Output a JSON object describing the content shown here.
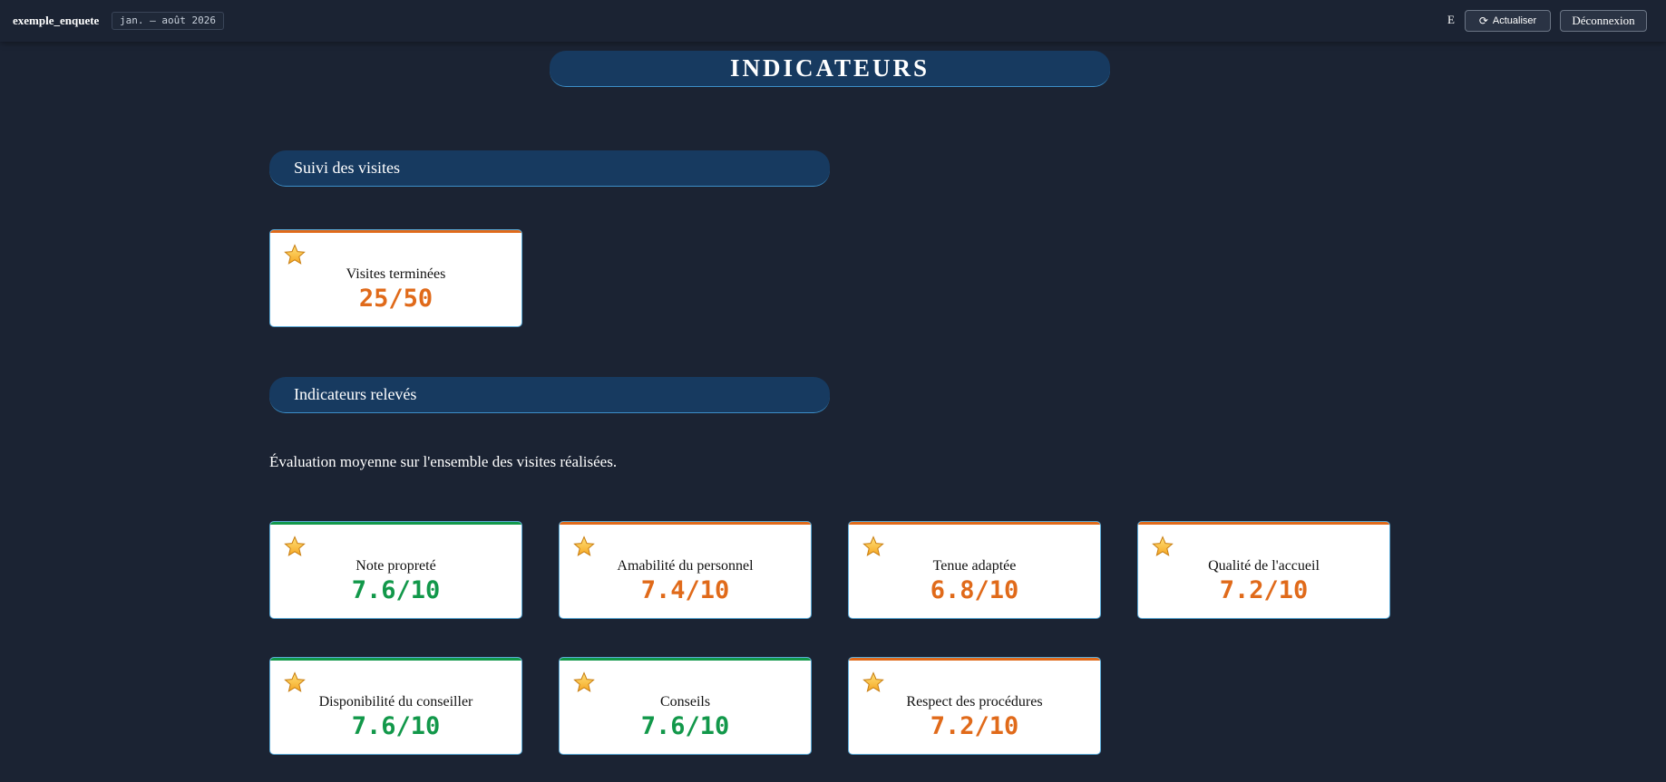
{
  "topbar": {
    "app_name": "exemple_enquete",
    "period": "jan. – août 2026",
    "user_initial": "E",
    "refresh_label": "Actualiser",
    "logout_label": "Déconnexion"
  },
  "page_title": "INDICATEURS",
  "colors": {
    "good": "#12984a",
    "warn": "#e06a1a",
    "header_bg": "#173a60",
    "page_bg": "#1b2333"
  },
  "sections": {
    "visits": {
      "title": "Suivi des visites",
      "card": {
        "label": "Visites terminées",
        "value": "25/50",
        "status": "warn"
      }
    },
    "indicators": {
      "title": "Indicateurs relevés",
      "description": "Évaluation moyenne sur l'ensemble des visites réalisées.",
      "cards": [
        {
          "label": "Note propreté",
          "value": "7.6/10",
          "status": "good"
        },
        {
          "label": "Amabilité du personnel",
          "value": "7.4/10",
          "status": "warn"
        },
        {
          "label": "Tenue adaptée",
          "value": "6.8/10",
          "status": "warn"
        },
        {
          "label": "Qualité de l'accueil",
          "value": "7.2/10",
          "status": "warn"
        },
        {
          "label": "Disponibilité du conseiller",
          "value": "7.6/10",
          "status": "good"
        },
        {
          "label": "Conseils",
          "value": "7.6/10",
          "status": "good"
        },
        {
          "label": "Respect des procédures",
          "value": "7.2/10",
          "status": "warn"
        }
      ]
    }
  }
}
